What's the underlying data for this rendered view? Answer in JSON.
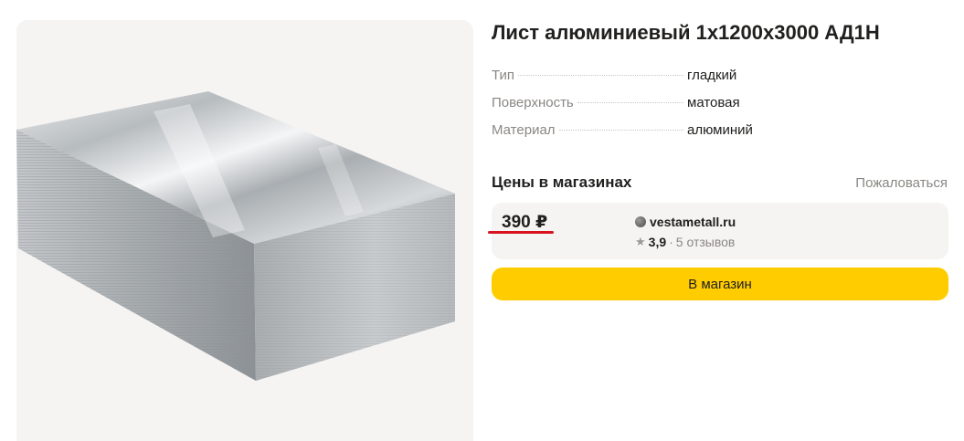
{
  "product": {
    "title": "Лист алюминиевый 1х1200х3000 АД1Н",
    "image_icon": "aluminum-sheet-photo"
  },
  "specs": [
    {
      "key": "Тип",
      "value": "гладкий"
    },
    {
      "key": "Поверхность",
      "value": "матовая"
    },
    {
      "key": "Материал",
      "value": "алюминий"
    }
  ],
  "prices": {
    "heading": "Цены в магазинах",
    "complain_label": "Пожаловаться"
  },
  "offer": {
    "price": "390 ₽",
    "shop_name": "vestametall.ru",
    "rating": "3,9",
    "separator": "·",
    "reviews": "5 отзывов"
  },
  "button": {
    "label": "В магазин"
  },
  "colors": {
    "accent_button": "#ffcc00",
    "price_underline": "#d9121f",
    "card_background": "#f5f4f2"
  }
}
